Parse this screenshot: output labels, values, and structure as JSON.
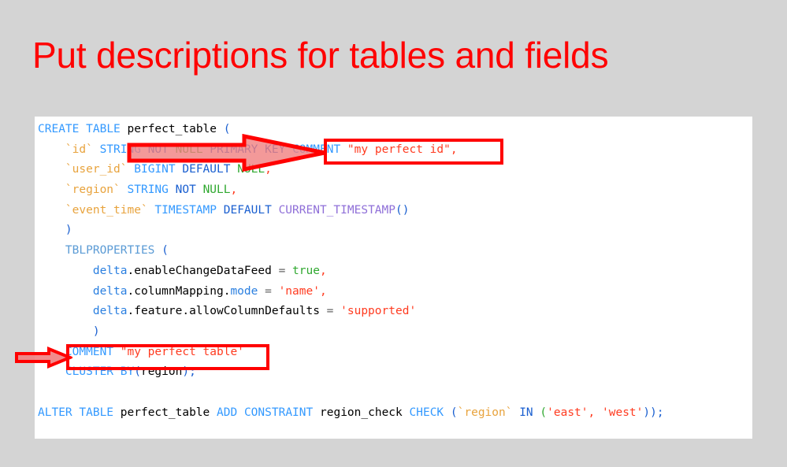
{
  "slide": {
    "title": "Put descriptions for tables and fields",
    "title_color": "#ff0000",
    "background_color": "#d4d4d4",
    "panel_color": "#ffffff"
  },
  "code": {
    "language": "sql",
    "lines": [
      "CREATE TABLE perfect_table (",
      "    `id` STRING NOT NULL PRIMARY KEY COMMENT \"my perfect id\",",
      "    `user_id` BIGINT DEFAULT NULL,",
      "    `region` STRING NOT NULL,",
      "    `event_time` TIMESTAMP DEFAULT CURRENT_TIMESTAMP()",
      "    )",
      "    TBLPROPERTIES (",
      "        delta.enableChangeDataFeed = true,",
      "        delta.columnMapping.mode = 'name',",
      "        delta.feature.allowColumnDefaults = 'supported'",
      "        )",
      "    COMMENT \"my perfect table'",
      "    CLUSTER BY(region);",
      "",
      "ALTER TABLE perfect_table ADD CONSTRAINT region_check CHECK (`region` IN ('east', 'west'));"
    ],
    "tokens": {
      "l1": {
        "create": "CREATE",
        "table": "TABLE",
        "name": "perfect_table",
        "paren": "("
      },
      "l2": {
        "col": "`id`",
        "type": "STRING",
        "not": "NOT",
        "null": "NULL",
        "primary": "PRIMARY",
        "key": "KEY",
        "comment": "COMMENT",
        "text": "\"my perfect id\"",
        "comma": ","
      },
      "l3": {
        "col": "`user_id`",
        "type": "BIGINT",
        "default": "DEFAULT",
        "null": "NULL",
        "comma": ","
      },
      "l4": {
        "col": "`region`",
        "type": "STRING",
        "not": "NOT",
        "null": "NULL",
        "comma": ","
      },
      "l5": {
        "col": "`event_time`",
        "type": "TIMESTAMP",
        "default": "DEFAULT",
        "fn": "CURRENT_TIMESTAMP",
        "parens": "()"
      },
      "l6": {
        "paren": ")"
      },
      "l7": {
        "kw": "TBLPROPERTIES",
        "paren": "("
      },
      "l8": {
        "ns": "delta",
        "prop": ".enableChangeDataFeed",
        "eq": "=",
        "val": "true",
        "comma": ","
      },
      "l9": {
        "ns": "delta",
        "prop": ".columnMapping.",
        "mode": "mode",
        "eq": "=",
        "val": "'name'",
        "comma": ","
      },
      "l10": {
        "ns": "delta",
        "prop": ".feature.allowColumnDefaults",
        "eq": "=",
        "val": "'supported'"
      },
      "l11": {
        "paren": ")"
      },
      "l12": {
        "comment": "COMMENT",
        "text": "\"my perfect table'"
      },
      "l13": {
        "cluster": "CLUSTER",
        "by": "BY",
        "open": "(",
        "col": "region",
        "close": ");"
      },
      "l15": {
        "alter": "ALTER",
        "table": "TABLE",
        "name": "perfect_table",
        "add": "ADD",
        "constraint": "CONSTRAINT",
        "cname": "region_check",
        "check": "CHECK",
        "open": "(",
        "col": "`region`",
        "in": "IN",
        "open2": "(",
        "east": "'east'",
        "comma": ",",
        "west": "'west'",
        "close": "));"
      }
    }
  },
  "annotations": {
    "highlight_color": "#ff0000",
    "arrow_fill": "#f08080",
    "arrow_stroke": "#ff0000",
    "boxes": [
      {
        "name": "column-comment-highlight",
        "target": "COMMENT \"my perfect id\""
      },
      {
        "name": "table-comment-highlight",
        "target": "COMMENT \"my perfect table'"
      }
    ],
    "arrows": [
      {
        "name": "arrow-to-column-comment",
        "direction": "right"
      },
      {
        "name": "arrow-to-table-comment",
        "direction": "right"
      }
    ]
  }
}
